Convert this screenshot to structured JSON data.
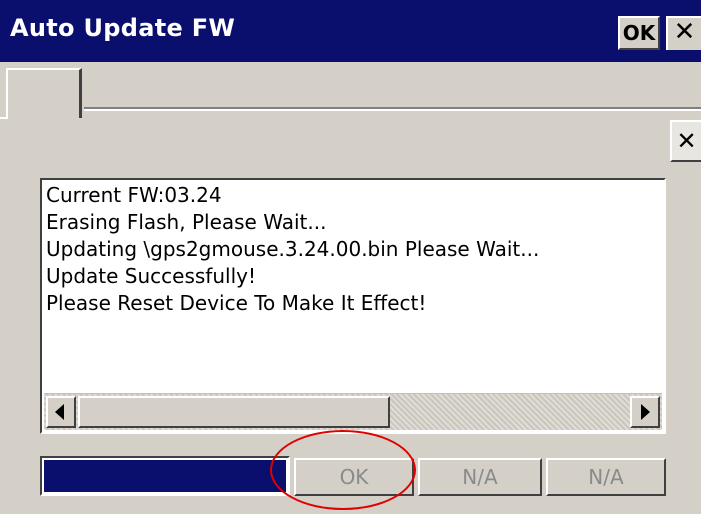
{
  "window": {
    "title": "Auto Update FW",
    "ok_label": "OK",
    "close_glyph": "✕"
  },
  "inner": {
    "close_glyph": "✕"
  },
  "log": {
    "lines": [
      "Current FW:03.24",
      "Erasing Flash, Please Wait...",
      "Updating \\gps2gmouse.3.24.00.bin Please Wait...",
      "Update Successfully!",
      "Please Reset Device To Make It Effect!"
    ]
  },
  "progress": {
    "percent": 100,
    "color": "#0a0f6e"
  },
  "buttons": {
    "ok_label": "OK",
    "na1_label": "N/A",
    "na2_label": "N/A"
  },
  "annotation": {
    "highlight_color": "#e00000"
  },
  "icons": {
    "scroll_left": "scroll-left-arrow-icon",
    "scroll_right": "scroll-right-arrow-icon",
    "close": "close-icon"
  }
}
